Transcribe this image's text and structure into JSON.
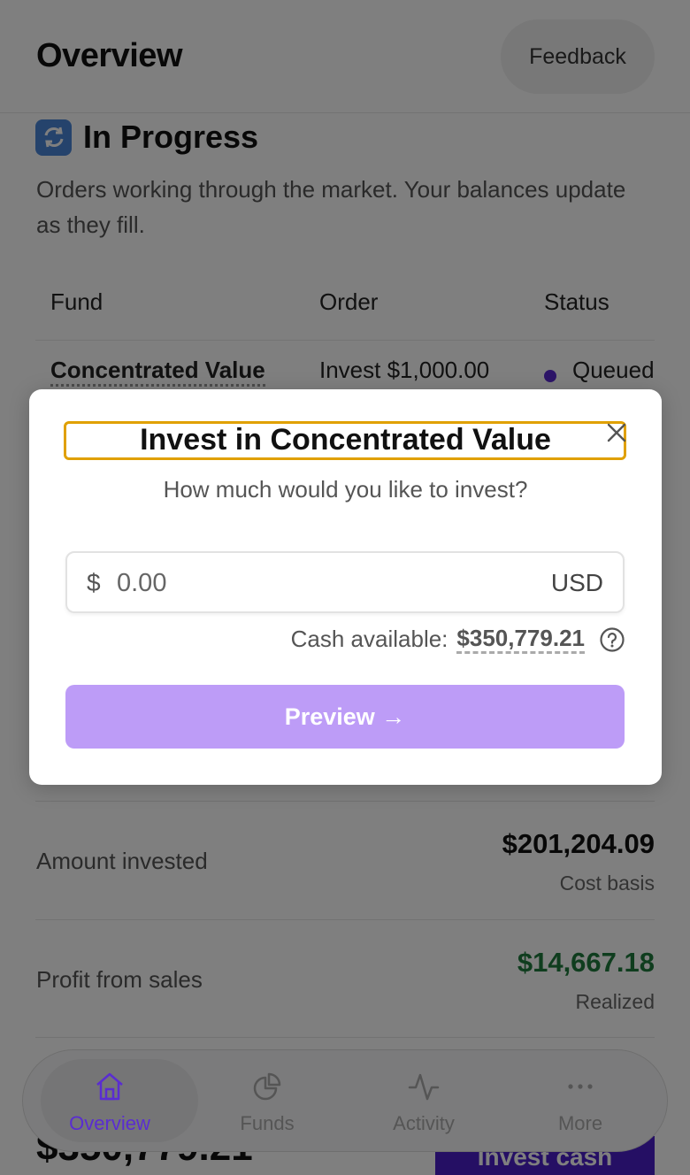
{
  "header": {
    "title": "Overview",
    "feedback_label": "Feedback"
  },
  "in_progress": {
    "icon": "sync-icon",
    "title": "In Progress",
    "description": "Orders working through the market. Your balances update as they fill.",
    "columns": [
      "Fund",
      "Order",
      "Status"
    ],
    "rows": [
      {
        "fund": "Concentrated Value",
        "order": "Invest $1,000.00",
        "status": "Queued"
      }
    ]
  },
  "stats": [
    {
      "label": "Amount invested",
      "value": "$201,204.09",
      "sub": "Cost basis",
      "value_color": "#111111"
    },
    {
      "label": "Profit from sales",
      "value": "$14,667.18",
      "sub": "Realized",
      "value_color": "#1e7a3c"
    }
  ],
  "bottom": {
    "big_value": "$350,779.21",
    "invest_cash_label": "Invest cash"
  },
  "tabbar": {
    "tabs": [
      {
        "label": "Overview",
        "icon": "home-icon",
        "active": true
      },
      {
        "label": "Funds",
        "icon": "pie-chart-icon",
        "active": false
      },
      {
        "label": "Activity",
        "icon": "activity-icon",
        "active": false
      },
      {
        "label": "More",
        "icon": "more-icon",
        "active": false
      }
    ]
  },
  "modal": {
    "title": "Invest in Concentrated Value",
    "subtitle": "How much would you like to invest?",
    "amount": {
      "symbol": "$",
      "placeholder": "0.00",
      "value": "",
      "currency": "USD"
    },
    "cash_label": "Cash available:",
    "cash_value": "$350,779.21",
    "preview_label": "Preview →"
  },
  "colors": {
    "accent": "#5a2dd1",
    "preview_button": "#bd9cf7",
    "positive": "#1e7a3c",
    "highlight_box": "#e0a000"
  }
}
